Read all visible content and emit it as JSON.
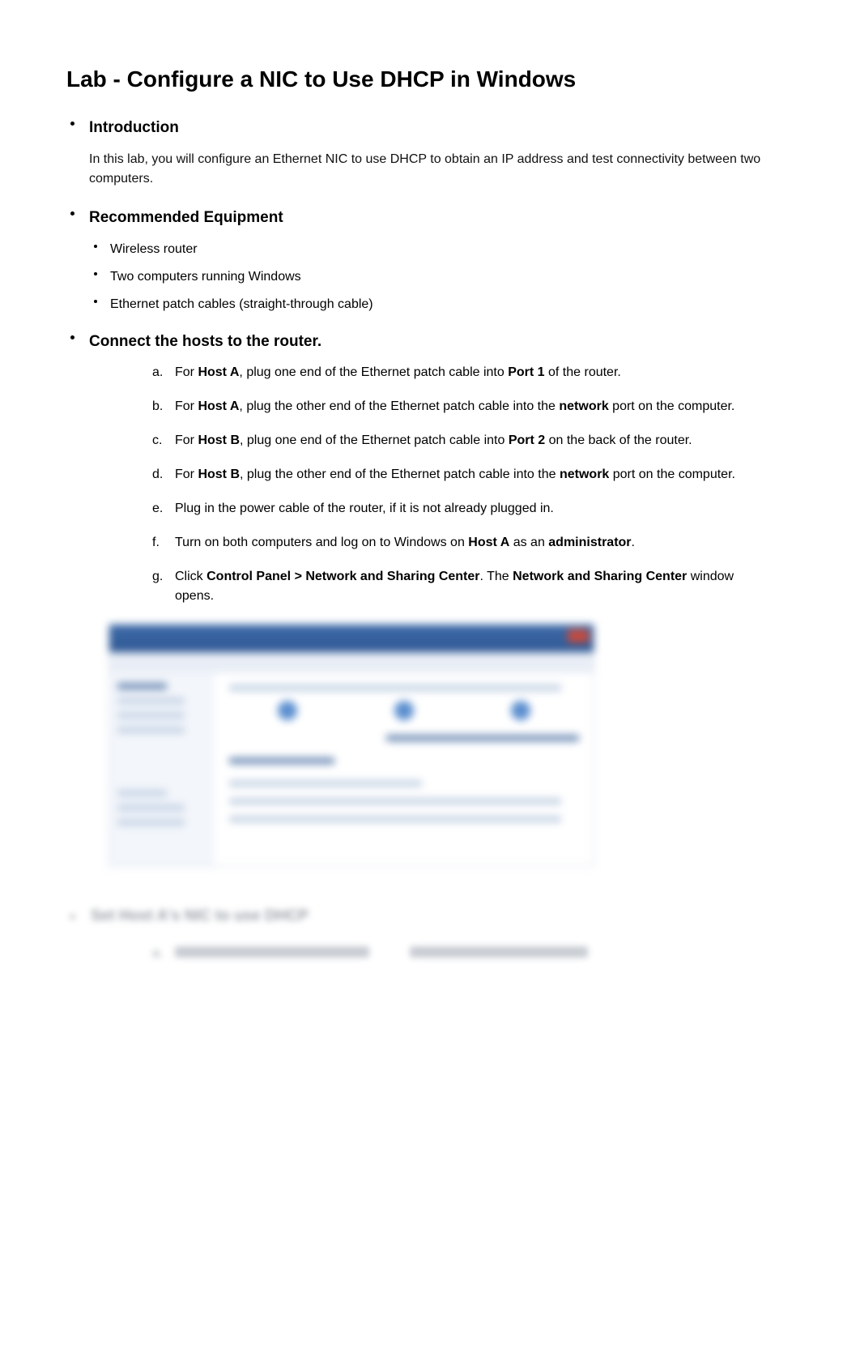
{
  "title": "Lab - Configure a NIC to Use DHCP in Windows",
  "sections": {
    "intro": {
      "heading": "Introduction",
      "body": "In this lab, you will configure an Ethernet NIC to use DHCP to obtain an IP address and test connectivity between two computers."
    },
    "equipment": {
      "heading": "Recommended Equipment",
      "items": [
        "Wireless router",
        "Two computers running Windows",
        "Ethernet patch cables (straight-through cable)"
      ]
    },
    "connect": {
      "heading": "Connect the hosts to the router.",
      "steps": [
        {
          "letter": "a.",
          "parts": [
            {
              "t": "For ",
              "b": false
            },
            {
              "t": "Host A",
              "b": true
            },
            {
              "t": ", plug one end of the Ethernet patch cable into ",
              "b": false
            },
            {
              "t": "Port 1",
              "b": true
            },
            {
              "t": " of the router.",
              "b": false
            }
          ]
        },
        {
          "letter": "b.",
          "parts": [
            {
              "t": "For ",
              "b": false
            },
            {
              "t": "Host A",
              "b": true
            },
            {
              "t": ", plug the other end of the Ethernet patch cable into the ",
              "b": false
            },
            {
              "t": "network",
              "b": true
            },
            {
              "t": " port on the computer.",
              "b": false
            }
          ]
        },
        {
          "letter": "c.",
          "parts": [
            {
              "t": "For ",
              "b": false
            },
            {
              "t": "Host B",
              "b": true
            },
            {
              "t": ", plug one end of the Ethernet patch cable into ",
              "b": false
            },
            {
              "t": "Port 2",
              "b": true
            },
            {
              "t": " on the back of the router.",
              "b": false
            }
          ]
        },
        {
          "letter": "d.",
          "parts": [
            {
              "t": "For ",
              "b": false
            },
            {
              "t": "Host B",
              "b": true
            },
            {
              "t": ", plug the other end of the Ethernet patch cable into the ",
              "b": false
            },
            {
              "t": "network",
              "b": true
            },
            {
              "t": " port on the computer.",
              "b": false
            }
          ]
        },
        {
          "letter": "e.",
          "parts": [
            {
              "t": "Plug in the power cable of the router, if it is not already plugged in.",
              "b": false
            }
          ]
        },
        {
          "letter": "f.",
          "parts": [
            {
              "t": "Turn on both computers and log on to Windows on ",
              "b": false
            },
            {
              "t": "Host A",
              "b": true
            },
            {
              "t": " as an ",
              "b": false
            },
            {
              "t": "administrator",
              "b": true
            },
            {
              "t": ".",
              "b": false
            }
          ]
        },
        {
          "letter": "g.",
          "parts": [
            {
              "t": "Click ",
              "b": false
            },
            {
              "t": "Control Panel > Network and Sharing Center",
              "b": true
            },
            {
              "t": ". The ",
              "b": false
            },
            {
              "t": "Network and Sharing Center",
              "b": true
            },
            {
              "t": " window opens.",
              "b": false
            }
          ]
        }
      ]
    },
    "blurred": {
      "heading": "Set Host A's NIC to use DHCP",
      "step_letter": "a.",
      "step_text_1": "Click Local Area Connection > Properties",
      "step_text_2": "The Local Area Connection Properties"
    }
  }
}
